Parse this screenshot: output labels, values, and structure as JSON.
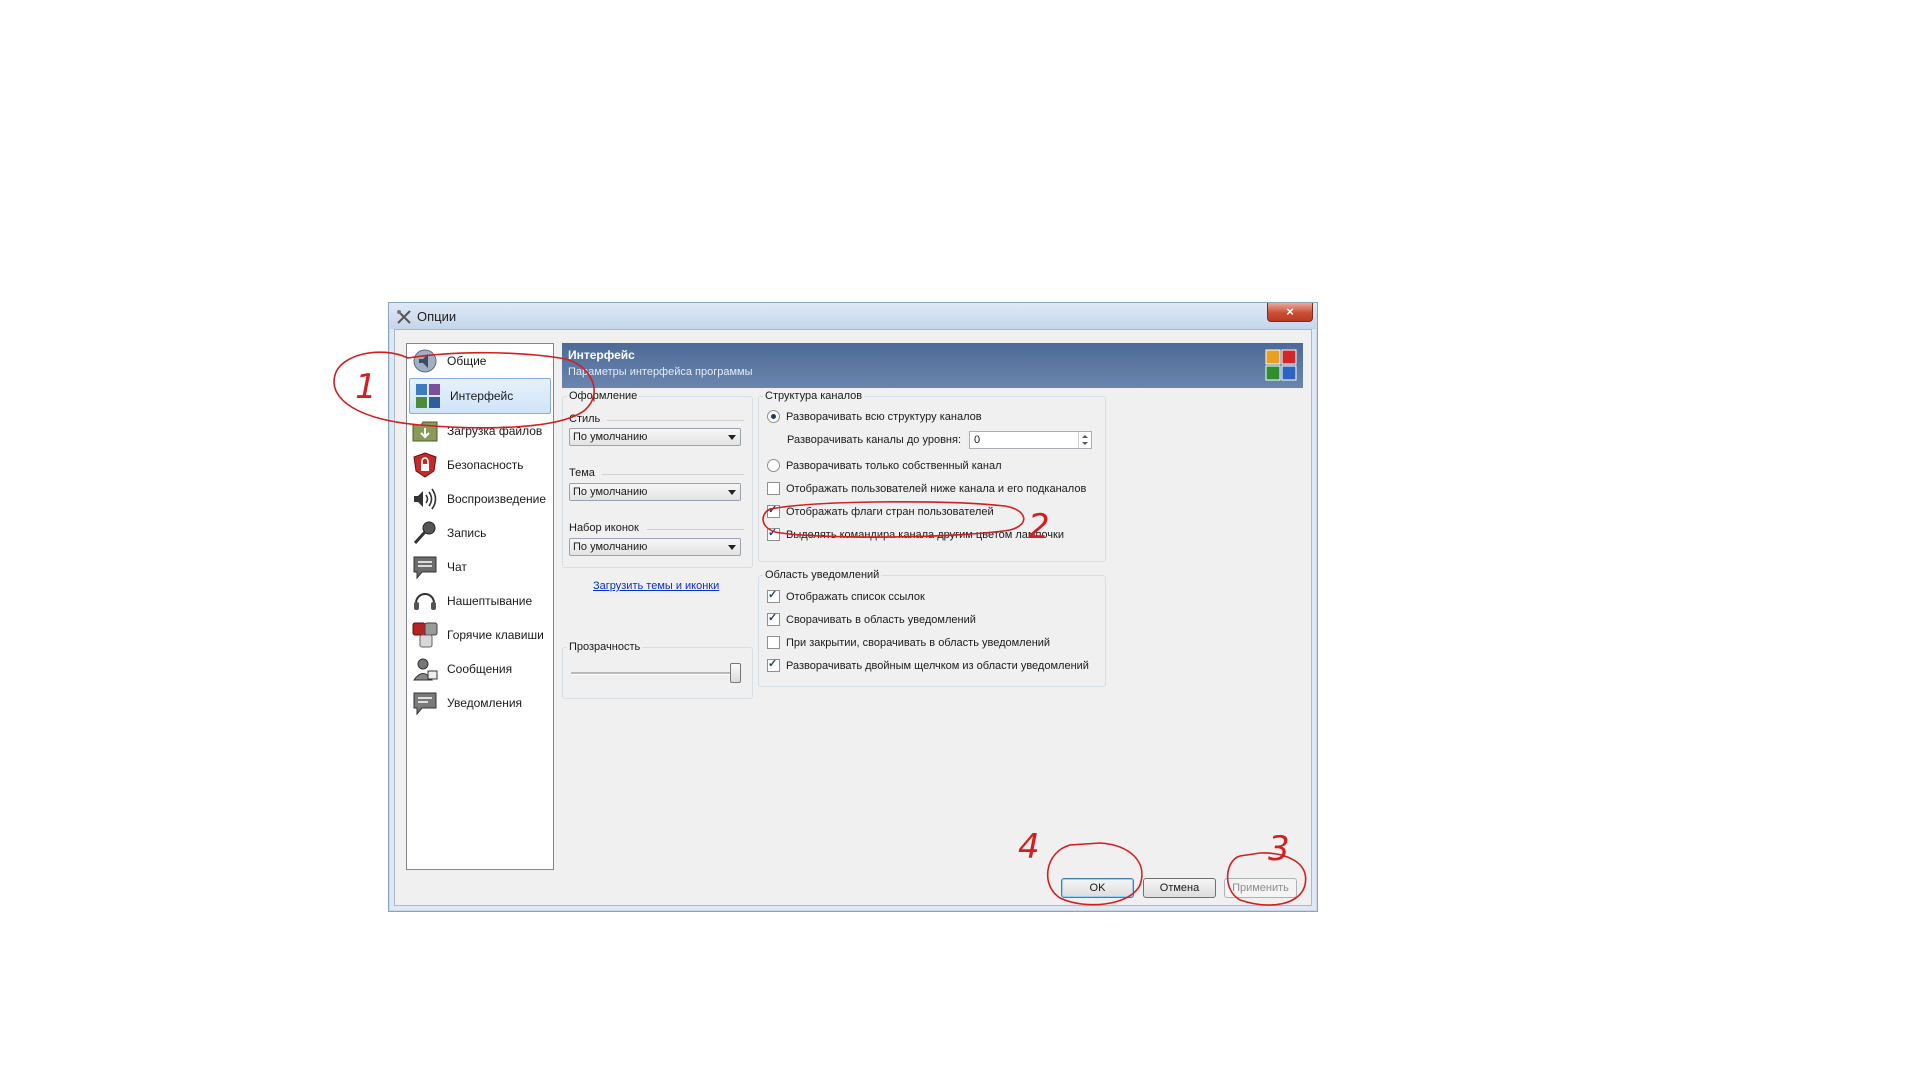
{
  "window": {
    "title": "Опции",
    "close_glyph": "×"
  },
  "sidebar": {
    "items": [
      {
        "label": "Общие",
        "icon": "speaker-icon"
      },
      {
        "label": "Интерфейс",
        "icon": "palette-icon",
        "active": true
      },
      {
        "label": "Загрузка файлов",
        "icon": "folder-icon"
      },
      {
        "label": "Безопасность",
        "icon": "lock-icon"
      },
      {
        "label": "Воспроизведение",
        "icon": "speaker-waves-icon"
      },
      {
        "label": "Запись",
        "icon": "microphone-icon"
      },
      {
        "label": "Чат",
        "icon": "chat-icon"
      },
      {
        "label": "Нашептывание",
        "icon": "headset-icon"
      },
      {
        "label": "Горячие клавиши",
        "icon": "keys-icon"
      },
      {
        "label": "Сообщения",
        "icon": "user-message-icon"
      },
      {
        "label": "Уведомления",
        "icon": "notification-icon"
      }
    ]
  },
  "header": {
    "title": "Интерфейс",
    "subtitle": "Параметры интерфейса программы"
  },
  "appearance": {
    "group_label": "Оформление",
    "style_label": "Стиль",
    "style_value": "По умолчанию",
    "theme_label": "Тема",
    "theme_value": "По умолчанию",
    "iconset_label": "Набор иконок",
    "iconset_value": "По умолчанию",
    "download_link": "Загрузить темы и иконки"
  },
  "transparency": {
    "group_label": "Прозрачность",
    "level": 1.0
  },
  "channel_tree": {
    "group_label": "Структура каналов",
    "expand_all": "Разворачивать всю структуру каналов",
    "expand_level_label": "Разворачивать каналы до уровня:",
    "expand_level_value": "0",
    "expand_own": "Разворачивать только собственный канал",
    "show_users_below": "Отображать пользователей ниже канала и его подканалов",
    "show_flags": "Отображать флаги стран пользователей",
    "highlight_commander": "Выделять командира канала другим цветом лампочки",
    "selected_radio": "expand_all",
    "checks": {
      "show_users_below": false,
      "show_flags": true,
      "highlight_commander": true
    }
  },
  "tray": {
    "group_label": "Область уведомлений",
    "show_links": "Отображать список ссылок",
    "minimize_to_tray": "Сворачивать в область уведомлений",
    "close_to_tray": "При закрытии, сворачивать в область уведомлений",
    "dblclick_restore": "Разворачивать двойным щелчком из области уведомлений",
    "checks": {
      "show_links": true,
      "minimize_to_tray": true,
      "close_to_tray": false,
      "dblclick_restore": true
    }
  },
  "buttons": {
    "ok": "OK",
    "cancel": "Отмена",
    "apply": "Применить"
  },
  "annotations": {
    "mark1": "1",
    "mark2": "2",
    "mark3": "3",
    "mark4": "4",
    "color": "#d21f1f"
  }
}
